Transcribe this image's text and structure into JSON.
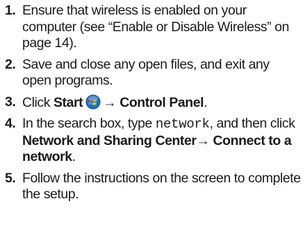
{
  "steps": [
    {
      "number": "1.",
      "text": "Ensure that wireless is enabled on your computer (see “Enable or Disable Wireless” on page 14)."
    },
    {
      "number": "2.",
      "text": "Save and close any open files, and exit any open programs."
    },
    {
      "number": "3.",
      "text_before": "Click ",
      "start_label": "Start",
      "start_icon": "windows-start-orb-icon",
      "arrow": "→",
      "control_panel_label": "Control Panel",
      "text_after": "."
    },
    {
      "number": "4.",
      "text_before": "In the search box, type ",
      "typed_value": "network",
      "text_middle": ", and then click ",
      "link1": "Network and Sharing Center",
      "arrow": "→",
      "link2": "Connect to a network",
      "text_after": "."
    },
    {
      "number": "5.",
      "text": "Follow the instructions on the screen to complete the setup."
    }
  ],
  "colors": {
    "text": "#1a1a1a",
    "orb_blue": "#1f6fc9",
    "flag_red": "#e8412f",
    "flag_green": "#7cc242",
    "flag_blue": "#3aa0e8",
    "flag_yellow": "#f7c320"
  }
}
